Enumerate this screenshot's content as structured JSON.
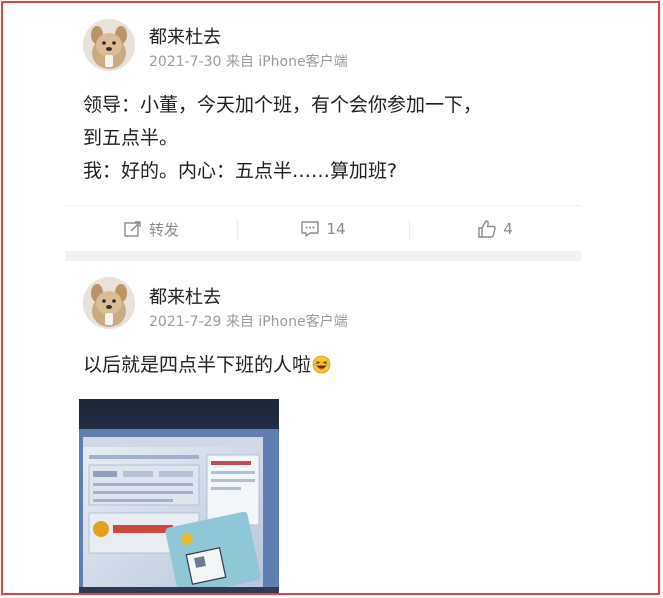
{
  "posts": [
    {
      "username": "都来杜去",
      "meta": "2021-7-30 来自 iPhone客户端",
      "lines": [
        "领导：小董，今天加个班，有个会你参加一下，",
        "到五点半。",
        "我：好的。内心：五点半……算加班?"
      ],
      "actions": {
        "repost_label": "转发",
        "comments": "14",
        "likes": "4"
      }
    },
    {
      "username": "都来杜去",
      "meta": "2021-7-29 来自 iPhone客户端",
      "text": "以后就是四点半下班的人啦"
    }
  ],
  "icons": {
    "repost": "edit-share-icon",
    "comment": "comment-icon",
    "like": "thumbs-up-icon",
    "emoji": "laughing-emoji-icon"
  },
  "colors": {
    "frame": "#e8413b",
    "meta_text": "#9a9a9a",
    "action_text": "#8a8a8a"
  }
}
